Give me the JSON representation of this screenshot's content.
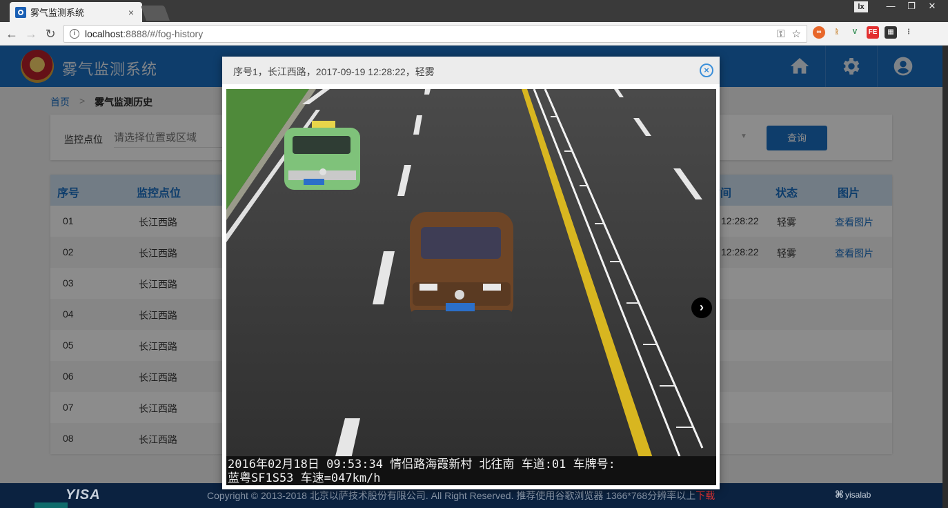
{
  "browser": {
    "tab_title": "雾气监测系统",
    "tab_close": "×",
    "user_badge": "lx",
    "window_controls": [
      "—",
      "❐",
      "✕"
    ],
    "url_host": "localhost",
    "url_rest": ":8888/#/fog-history"
  },
  "app": {
    "title": "雾气监测系统"
  },
  "breadcrumb": {
    "home": "首页",
    "separator": ">",
    "current": "雾气监测历史"
  },
  "filter": {
    "label": "监控点位",
    "placeholder": "请选择位置或区域",
    "query_label": "查询"
  },
  "table": {
    "headers": [
      "序号",
      "监控点位",
      "时间",
      "状态",
      "图片"
    ],
    "rows": [
      {
        "no": "01",
        "location": "长江西路",
        "time": "12:28:22",
        "status": "轻雾",
        "image": "查看图片"
      },
      {
        "no": "02",
        "location": "长江西路",
        "time": "12:28:22",
        "status": "轻雾",
        "image": "查看图片"
      },
      {
        "no": "03",
        "location": "长江西路",
        "time": "",
        "status": "",
        "image": ""
      },
      {
        "no": "04",
        "location": "长江西路",
        "time": "",
        "status": "",
        "image": ""
      },
      {
        "no": "05",
        "location": "长江西路",
        "time": "",
        "status": "",
        "image": ""
      },
      {
        "no": "06",
        "location": "长江西路",
        "time": "",
        "status": "",
        "image": ""
      },
      {
        "no": "07",
        "location": "长江西路",
        "time": "",
        "status": "",
        "image": ""
      },
      {
        "no": "08",
        "location": "长江西路",
        "time": "",
        "status": "",
        "image": ""
      }
    ]
  },
  "footer": {
    "logo": "YISA",
    "copyright": "Copyright © 2013-2018 北京以萨技术股份有限公司. All Right Reserved. 推荐使用谷歌浏览器 1366*768分辨率以上",
    "download": "下载",
    "brand": "yisalab"
  },
  "modal": {
    "title": "序号1，长江西路，2017-09-19 12:28:22，轻雾",
    "close_glyph": "×",
    "next_glyph": "›",
    "caption_line1": "2016年02月18日 09:53:34 情侣路海霞新村 北往南 车道:01 车牌号:",
    "caption_line2": "蓝粤SF1S53  车速=047km/h",
    "plate_front": "粤SF1S53",
    "plate_taxi": "粤C·XK67",
    "colors": {
      "accent": "#1a6fc4",
      "header": "#1a6fc4",
      "footer": "#0b2240"
    }
  }
}
